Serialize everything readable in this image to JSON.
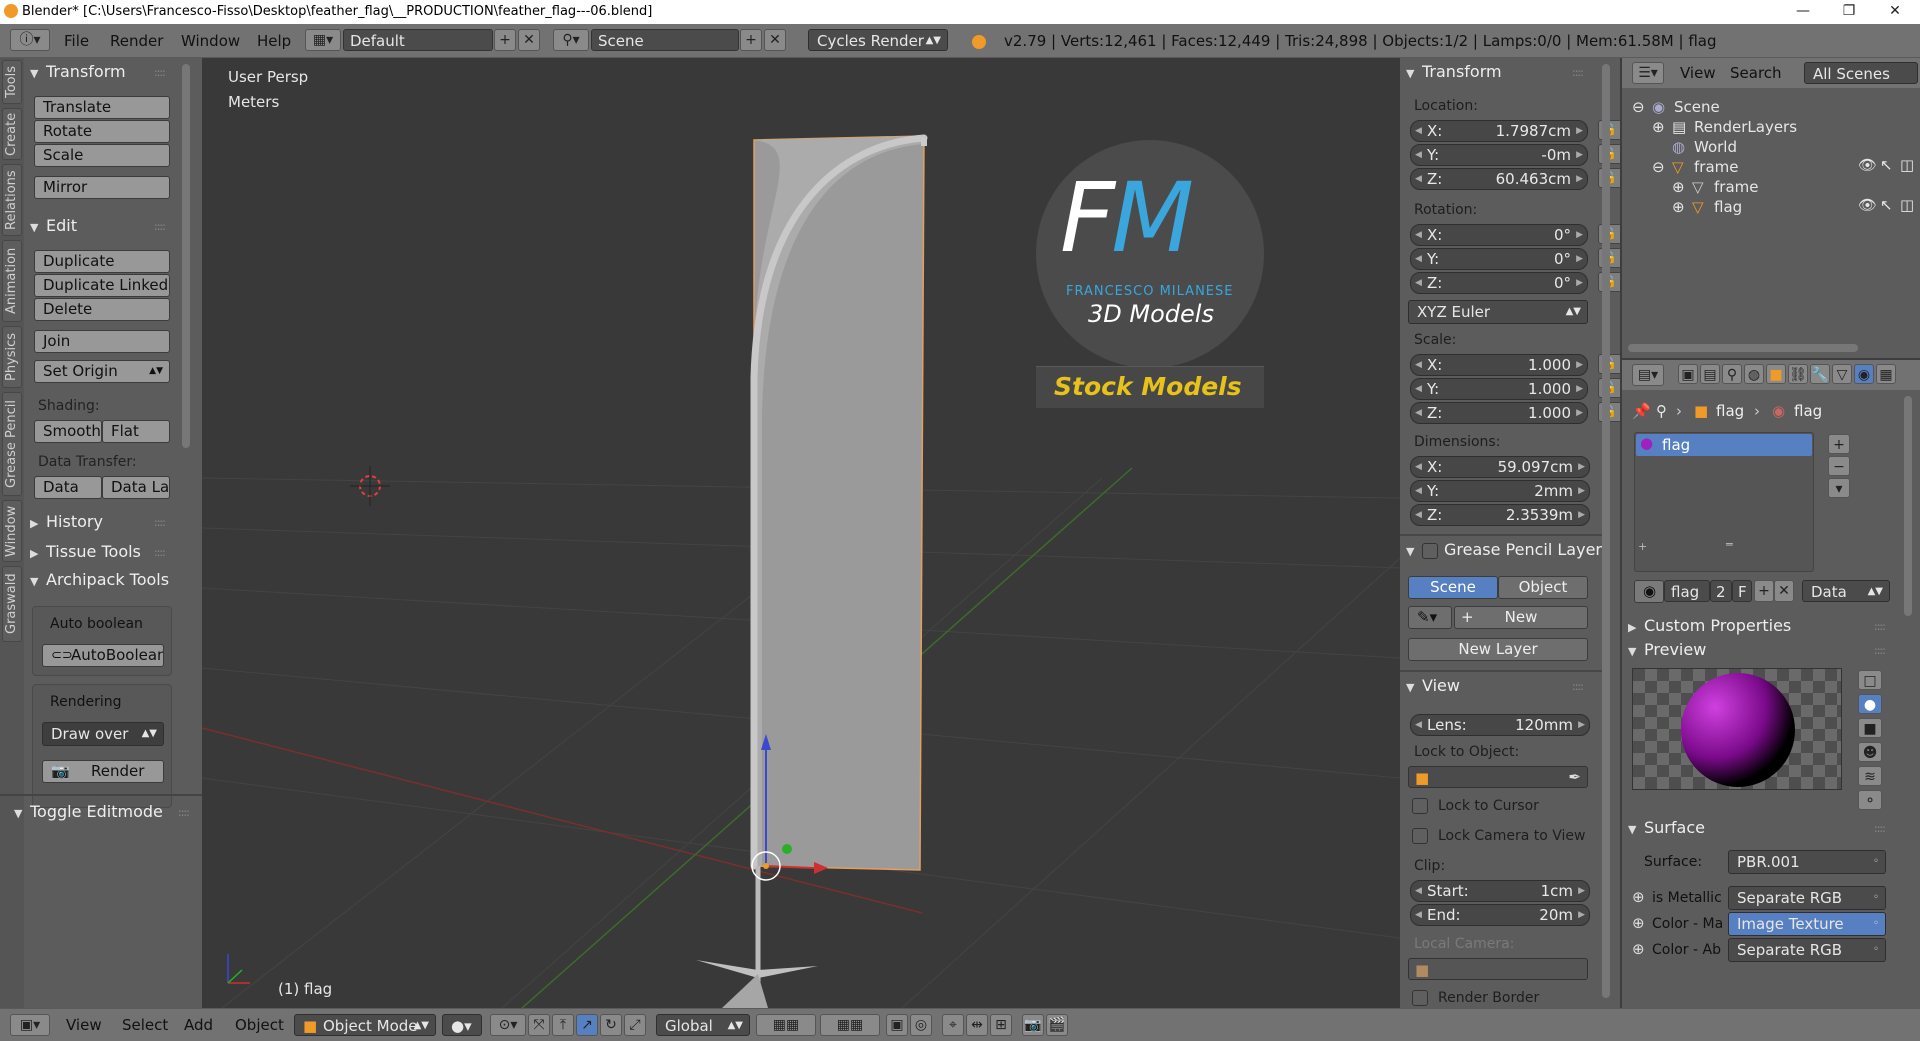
{
  "titlebar": {
    "title": "Blender* [C:\\Users\\Francesco-Fisso\\Desktop\\feather_flag\\__PRODUCTION\\feather_flag---06.blend]",
    "minimize": "—",
    "maximize": "❐",
    "close": "✕"
  },
  "topbar": {
    "menus": [
      "File",
      "Render",
      "Window",
      "Help"
    ],
    "layout": "Default",
    "scene": "Scene",
    "engine": "Cycles Render",
    "stats": "v2.79 | Verts:12,461 | Faces:12,449 | Tris:24,898 | Objects:1/2 | Lamps:0/0 | Mem:61.58M | flag"
  },
  "tool_tabs": [
    "Tools",
    "Create",
    "Relations",
    "Animation",
    "Physics",
    "Grease Pencil",
    "Window",
    "Graswald"
  ],
  "toolshelf": {
    "transform": {
      "header": "Transform",
      "buttons": [
        "Translate",
        "Rotate",
        "Scale",
        "Mirror"
      ]
    },
    "edit": {
      "header": "Edit",
      "buttons": [
        "Duplicate",
        "Duplicate Linked",
        "Delete",
        "Join"
      ],
      "set_origin": "Set Origin",
      "shading_label": "Shading:",
      "smooth": "Smooth",
      "flat": "Flat",
      "data_transfer_label": "Data Transfer:",
      "data": "Data",
      "data_la": "Data La"
    },
    "history": "History",
    "tissue": "Tissue Tools",
    "archipack": "Archipack Tools",
    "auto_boolean_label": "Auto boolean",
    "auto_boolean_btn": "AutoBoolean",
    "rendering_label": "Rendering",
    "draw_over": "Draw over",
    "render_btn": "Render",
    "toggle_editmode": "Toggle Editmode"
  },
  "viewport": {
    "persp": "User Persp",
    "units": "Meters",
    "object_label": "(1) flag",
    "logo_big": "FM",
    "logo_sub": "FRANCESCO MILANESE",
    "logo_models": "3D Models",
    "stock": "Stock Models"
  },
  "nprops": {
    "transform_header": "Transform",
    "location_label": "Location:",
    "location": [
      {
        "k": "X:",
        "v": "1.7987cm"
      },
      {
        "k": "Y:",
        "v": "-0m"
      },
      {
        "k": "Z:",
        "v": "60.463cm"
      }
    ],
    "rotation_label": "Rotation:",
    "rotation": [
      {
        "k": "X:",
        "v": "0°"
      },
      {
        "k": "Y:",
        "v": "0°"
      },
      {
        "k": "Z:",
        "v": "0°"
      }
    ],
    "rotation_mode": "XYZ Euler",
    "scale_label": "Scale:",
    "scale": [
      {
        "k": "X:",
        "v": "1.000"
      },
      {
        "k": "Y:",
        "v": "1.000"
      },
      {
        "k": "Z:",
        "v": "1.000"
      }
    ],
    "dimensions_label": "Dimensions:",
    "dimensions": [
      {
        "k": "X:",
        "v": "59.097cm"
      },
      {
        "k": "Y:",
        "v": "2mm"
      },
      {
        "k": "Z:",
        "v": "2.3539m"
      }
    ],
    "gp_header": "Grease Pencil Layer",
    "gp_scene": "Scene",
    "gp_object": "Object",
    "gp_new": "New",
    "gp_new_layer": "New Layer",
    "view_header": "View",
    "lens_label": "Lens:",
    "lens_value": "120mm",
    "lock_object_label": "Lock to Object:",
    "lock_cursor": "Lock to Cursor",
    "lock_camera": "Lock Camera to View",
    "clip_label": "Clip:",
    "clip_start_label": "Start:",
    "clip_start": "1cm",
    "clip_end_label": "End:",
    "clip_end": "20m",
    "local_camera": "Local Camera:",
    "render_border": "Render Border"
  },
  "outliner": {
    "view": "View",
    "search": "Search",
    "all_scenes": "All Scenes",
    "items": [
      "Scene",
      "RenderLayers",
      "World",
      "frame",
      "frame",
      "flag"
    ]
  },
  "properties": {
    "breadcrumb_obj": "flag",
    "breadcrumb_mat": "flag",
    "material_slot": "flag",
    "mat_name": "flag",
    "mat_users": "2",
    "mat_fake": "F",
    "mat_link": "Data",
    "custom_props": "Custom Properties",
    "preview": "Preview",
    "surface_header": "Surface",
    "surface_label": "Surface:",
    "surface_value": "PBR.001",
    "inputs": [
      {
        "label": "is Metallic",
        "value": "Separate RGB"
      },
      {
        "label": "Color - Ma",
        "value": "Image Texture"
      },
      {
        "label": "Color - Ab",
        "value": "Separate RGB"
      }
    ]
  },
  "bottombar": {
    "menus": [
      "View",
      "Select",
      "Add",
      "Object"
    ],
    "mode": "Object Mode",
    "orientation": "Global"
  },
  "colors": {
    "selection_blue": "#5680c2",
    "accent_orange": "#f09a2a",
    "logo_blue": "#3aa6dc",
    "stock_yellow": "#e6c21a"
  }
}
